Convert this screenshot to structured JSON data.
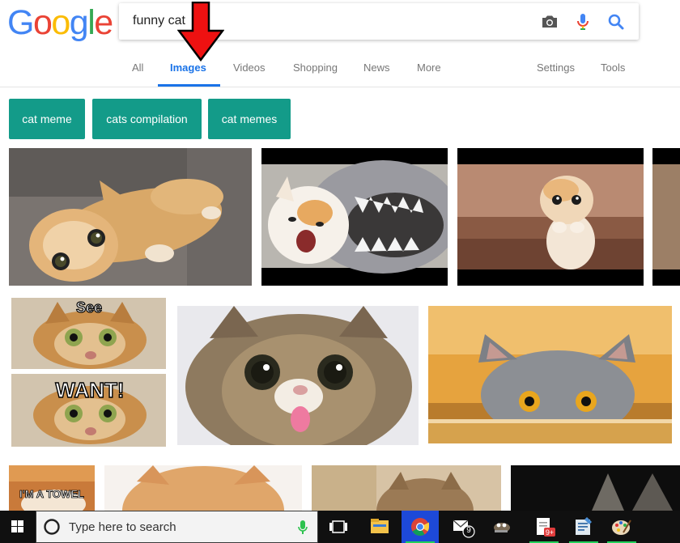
{
  "header": {
    "logo_letters": [
      "G",
      "o",
      "o",
      "g",
      "l",
      "e"
    ],
    "logo_colors": [
      "#4285F4",
      "#EA4335",
      "#FBBC05",
      "#4285F4",
      "#34A853",
      "#EA4335"
    ],
    "search_value": "funny cat",
    "icons": [
      "camera-icon",
      "microphone-icon",
      "search-icon"
    ]
  },
  "nav": {
    "tabs": [
      {
        "label": "All",
        "active": false
      },
      {
        "label": "Images",
        "active": true
      },
      {
        "label": "Videos",
        "active": false
      },
      {
        "label": "Shopping",
        "active": false
      },
      {
        "label": "News",
        "active": false
      },
      {
        "label": "More",
        "active": false
      }
    ],
    "settings_label": "Settings",
    "tools_label": "Tools",
    "accent": "#1a73e8"
  },
  "chips": [
    {
      "label": "cat meme"
    },
    {
      "label": "cats compilation"
    },
    {
      "label": "cat memes"
    }
  ],
  "chip_color": "#139b89",
  "images": {
    "meme1_top": "See",
    "meme1_bottom": "WANT!",
    "meme2_text": "I'M A TOWEL"
  },
  "taskbar": {
    "search_placeholder": "Type here to search",
    "mail_badge": "9",
    "doc_badge": "9+",
    "running_color": "#21d15a"
  }
}
